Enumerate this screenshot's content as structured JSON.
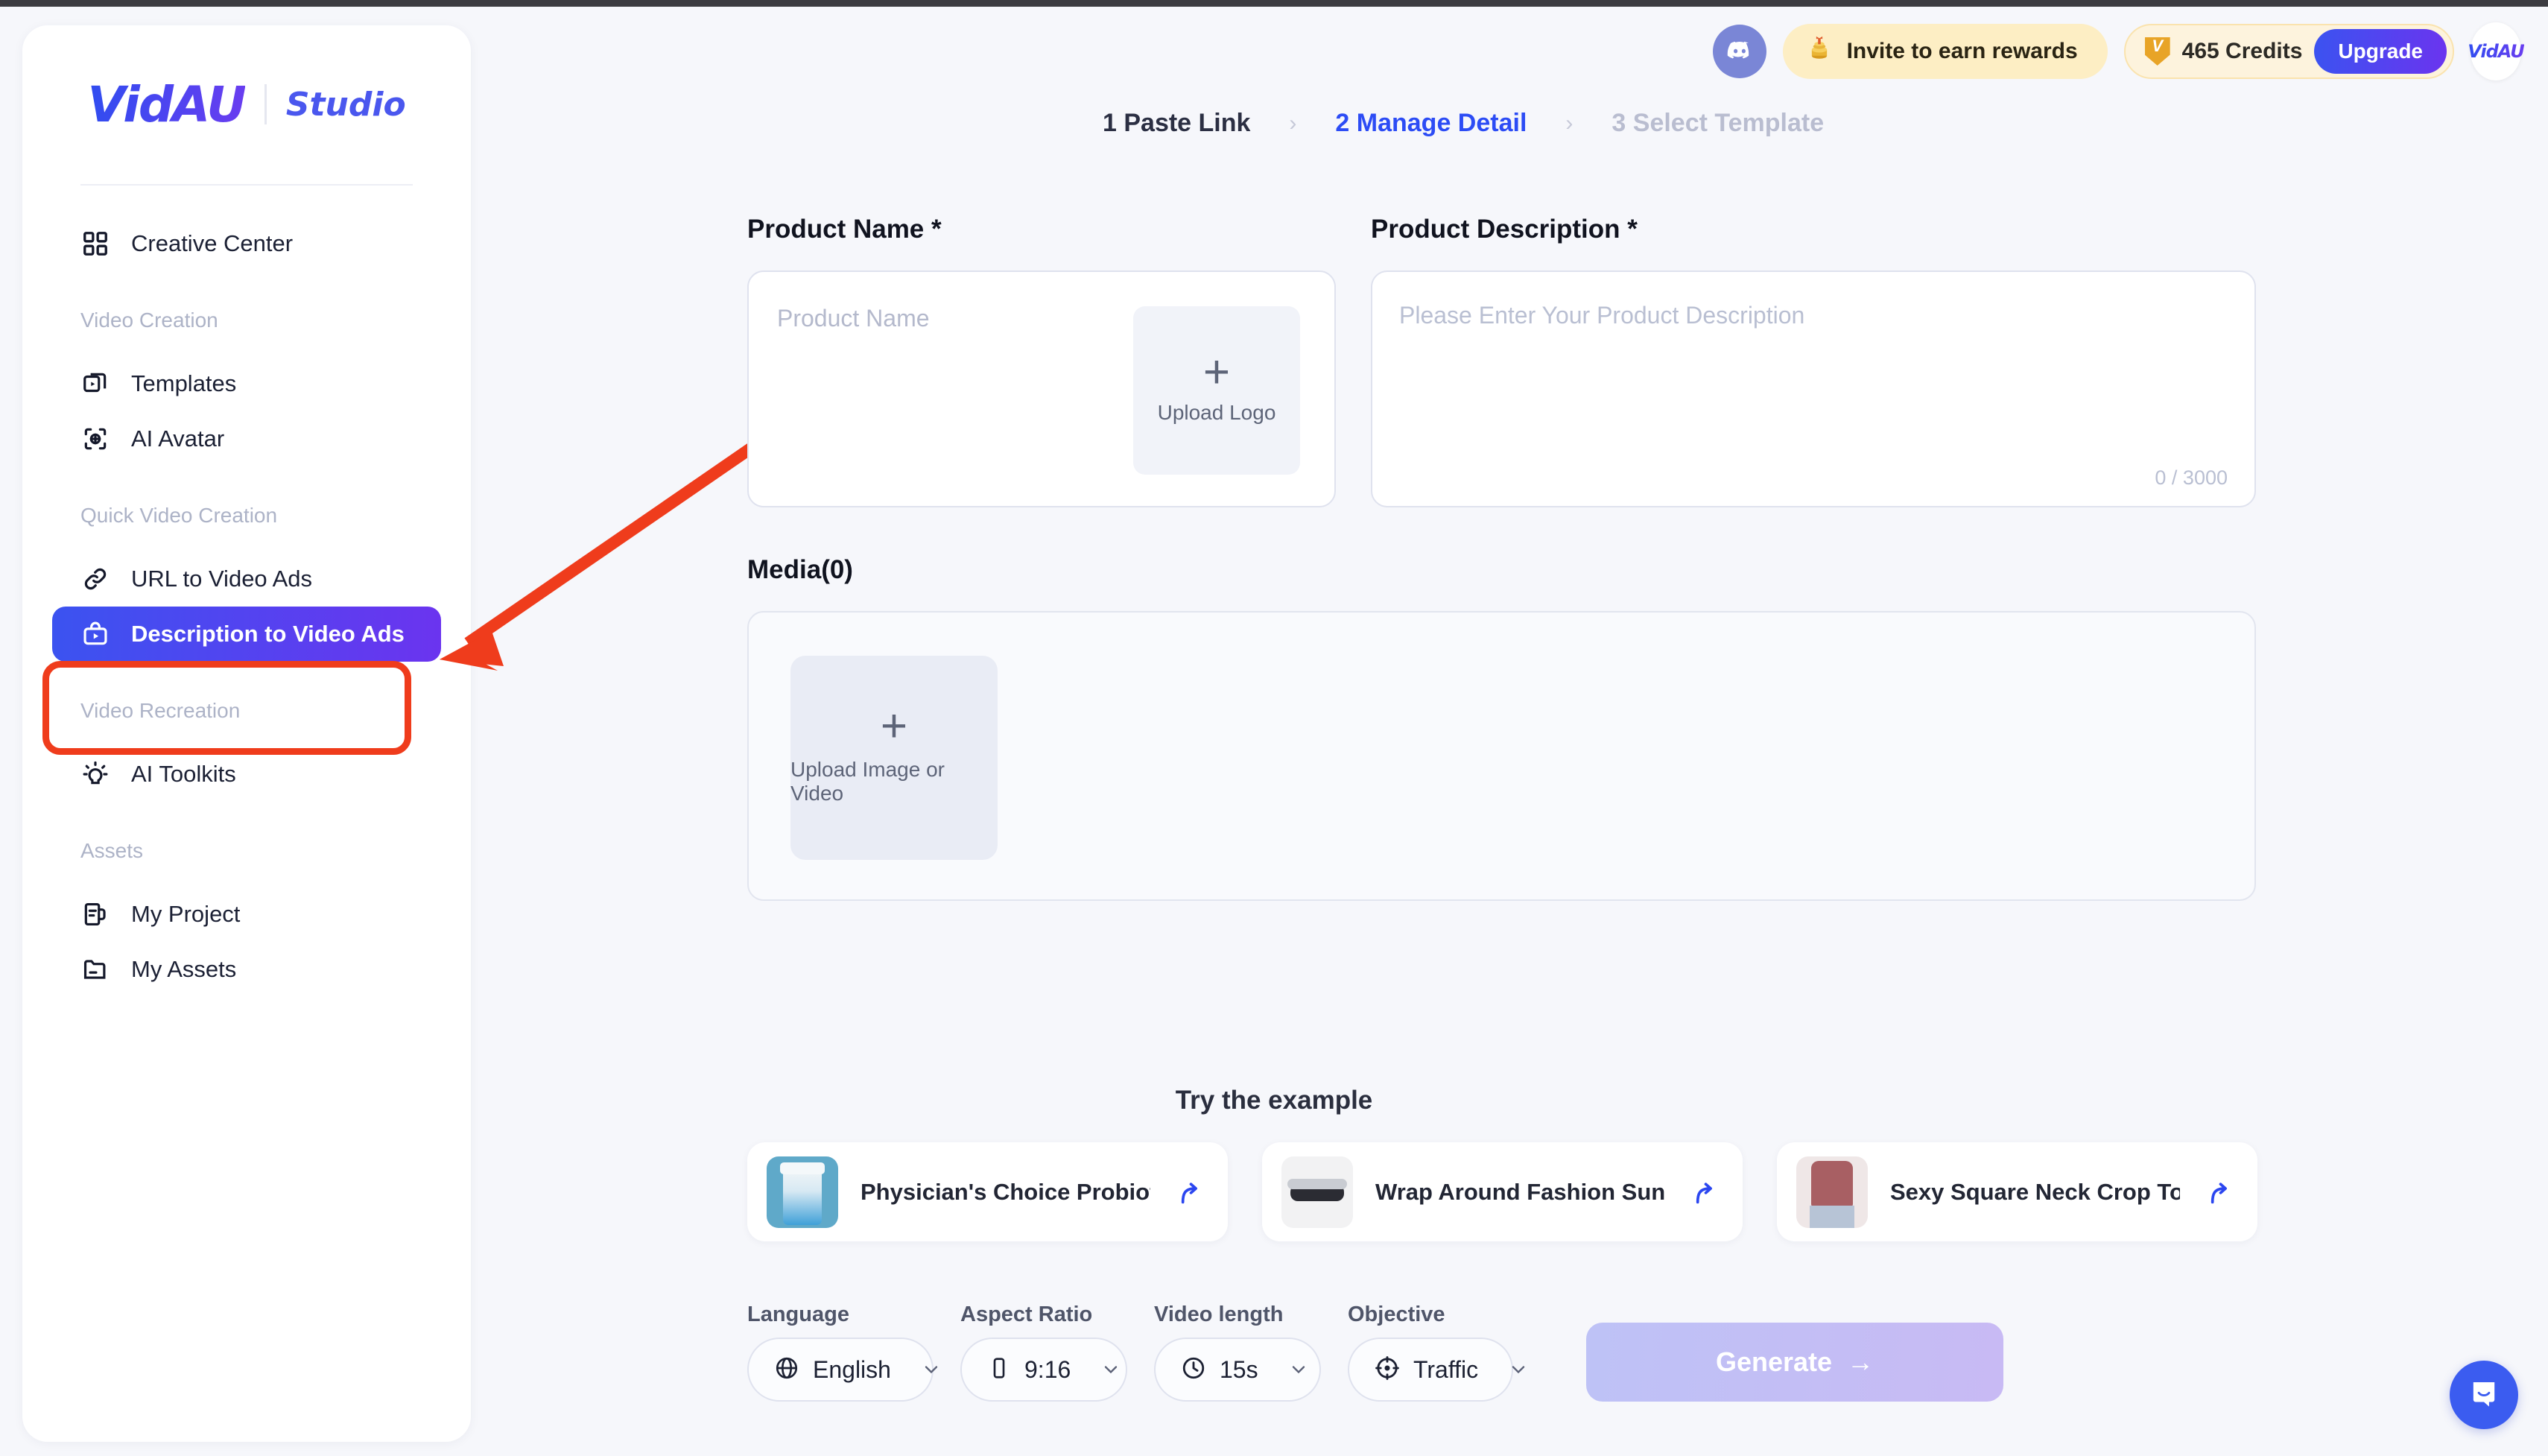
{
  "brand": {
    "logo": "VidAU",
    "sub": "Studio"
  },
  "sidebar": {
    "primary": {
      "label": "Creative Center",
      "icon": "grid-icon"
    },
    "groups": [
      {
        "label": "Video Creation",
        "items": [
          {
            "label": "Templates",
            "icon": "templates-icon",
            "active": false
          },
          {
            "label": "AI Avatar",
            "icon": "ai-avatar-icon",
            "active": false
          }
        ]
      },
      {
        "label": "Quick Video Creation",
        "items": [
          {
            "label": "URL to Video Ads",
            "icon": "link-icon",
            "active": false
          },
          {
            "label": "Description to Video Ads",
            "icon": "bag-play-icon",
            "active": true
          }
        ]
      },
      {
        "label": "Video Recreation",
        "items": [
          {
            "label": "AI Toolkits",
            "icon": "lightbulb-icon",
            "active": false
          }
        ]
      },
      {
        "label": "Assets",
        "items": [
          {
            "label": "My Project",
            "icon": "project-icon",
            "active": false
          },
          {
            "label": "My Assets",
            "icon": "folder-icon",
            "active": false
          }
        ]
      }
    ]
  },
  "header": {
    "discord_icon": "discord-icon",
    "invite_label": "Invite to earn rewards",
    "invite_icon": "coins-icon",
    "credits_label": "465 Credits",
    "credits_icon": "v-token-icon",
    "upgrade_label": "Upgrade",
    "avatar_label": "VidAU"
  },
  "steps": [
    {
      "label": "1 Paste Link",
      "state": "done"
    },
    {
      "label": "2 Manage Detail",
      "state": "current"
    },
    {
      "label": "3 Select Template",
      "state": "future"
    }
  ],
  "step_separator": "›",
  "form": {
    "product_name_label": "Product Name *",
    "product_name_placeholder": "Product Name",
    "product_name_value": "",
    "upload_logo_label": "Upload Logo",
    "product_description_label": "Product Description *",
    "product_description_placeholder": "Please Enter Your Product Description",
    "product_description_value": "",
    "description_counter": "0 / 3000",
    "media_label": "Media(0)",
    "upload_media_label": "Upload Image or Video",
    "plus_glyph": "+"
  },
  "examples": {
    "title": "Try the example",
    "cards": [
      {
        "title": "Physician's Choice Probiot...",
        "thumb": "probiotic-bottle-thumbnail",
        "action_icon": "use-example-arrow-icon"
      },
      {
        "title": "Wrap Around Fashion Sun...",
        "thumb": "sunglasses-thumbnail",
        "action_icon": "use-example-arrow-icon"
      },
      {
        "title": "Sexy Square Neck Crop To...",
        "thumb": "crop-top-thumbnail",
        "action_icon": "use-example-arrow-icon"
      }
    ]
  },
  "controls": {
    "language": {
      "label": "Language",
      "value": "English",
      "icon": "globe-icon"
    },
    "aspect_ratio": {
      "label": "Aspect Ratio",
      "value": "9:16",
      "icon": "phone-icon"
    },
    "video_length": {
      "label": "Video length",
      "value": "15s",
      "icon": "clock-icon"
    },
    "objective": {
      "label": "Objective",
      "value": "Traffic",
      "icon": "target-icon"
    },
    "generate_label": "Generate",
    "generate_arrow": "→"
  },
  "chat": {
    "icon": "chat-bubble-icon"
  },
  "annotation": {
    "highlight_target": "Description to Video Ads",
    "color": "#ef3c1c"
  },
  "colors": {
    "accent_blue": "#2c4cf5",
    "brand_gradient_start": "#3b53f0",
    "brand_gradient_end": "#6b34ef",
    "annotation_red": "#ef3c1c",
    "page_bg": "#f6f7fb"
  }
}
